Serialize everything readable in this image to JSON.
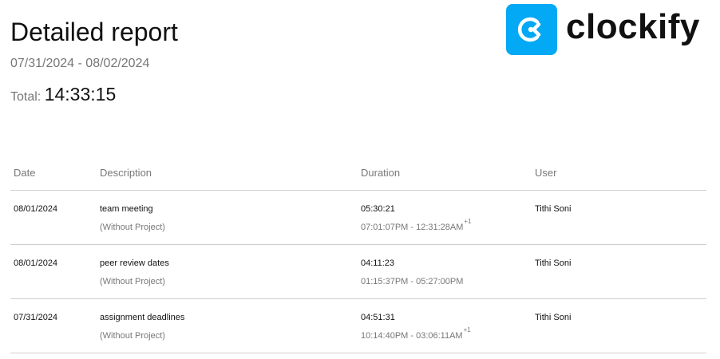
{
  "header": {
    "title": "Detailed report",
    "date_range": "07/31/2024 - 08/02/2024",
    "total_label": "Total:",
    "total_value": "14:33:15"
  },
  "logo": {
    "text": "clockify",
    "mark_color": "#03a9f4",
    "icon": "clockify-logo-icon"
  },
  "table": {
    "columns": [
      "Date",
      "Description",
      "Duration",
      "User"
    ],
    "rows": [
      {
        "date": "08/01/2024",
        "description": "team meeting",
        "project": "(Without Project)",
        "duration": "05:30:21",
        "time_range": "07:01:07PM - 12:31:28AM",
        "day_offset": "+1",
        "user": "Tithi Soni"
      },
      {
        "date": "08/01/2024",
        "description": "peer review dates",
        "project": "(Without Project)",
        "duration": "04:11:23",
        "time_range": "01:15:37PM - 05:27:00PM",
        "day_offset": "",
        "user": "Tithi Soni"
      },
      {
        "date": "07/31/2024",
        "description": "assignment deadlines",
        "project": "(Without Project)",
        "duration": "04:51:31",
        "time_range": "10:14:40PM - 03:06:11AM",
        "day_offset": "+1",
        "user": "Tithi Soni"
      }
    ]
  }
}
